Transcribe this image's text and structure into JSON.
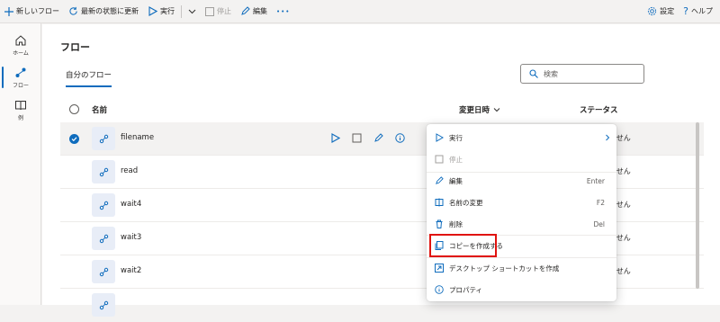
{
  "toolbar": {
    "new_flow": "新しいフロー",
    "refresh": "最新の状態に更新",
    "run": "実行",
    "stop": "停止",
    "edit": "編集",
    "more": "•••",
    "settings": "設定",
    "help": "ヘルプ"
  },
  "nav": {
    "home": "ホーム",
    "flows": "フロー",
    "examples": "例"
  },
  "page": {
    "title": "フロー",
    "tab_my_flows": "自分のフロー",
    "search_placeholder": "検索"
  },
  "table": {
    "col_name": "名前",
    "col_modified": "変更日時",
    "col_status": "ステータス",
    "rows": [
      {
        "name": "filename",
        "status": "ません"
      },
      {
        "name": "read",
        "status": "ません"
      },
      {
        "name": "wait4",
        "status": "ません"
      },
      {
        "name": "wait3",
        "status": "ません"
      },
      {
        "name": "wait2",
        "status": "ません"
      }
    ]
  },
  "context_menu": {
    "run": "実行",
    "stop": "停止",
    "edit": "編集",
    "edit_shortcut": "Enter",
    "rename": "名前の変更",
    "rename_shortcut": "F2",
    "delete": "削除",
    "delete_shortcut": "Del",
    "copy": "コピーを作成する",
    "desktop_shortcut": "デスクトップ ショートカットを作成",
    "properties": "プロパティ"
  },
  "colors": {
    "accent": "#0f6cbd",
    "highlight": "#e0130f"
  }
}
